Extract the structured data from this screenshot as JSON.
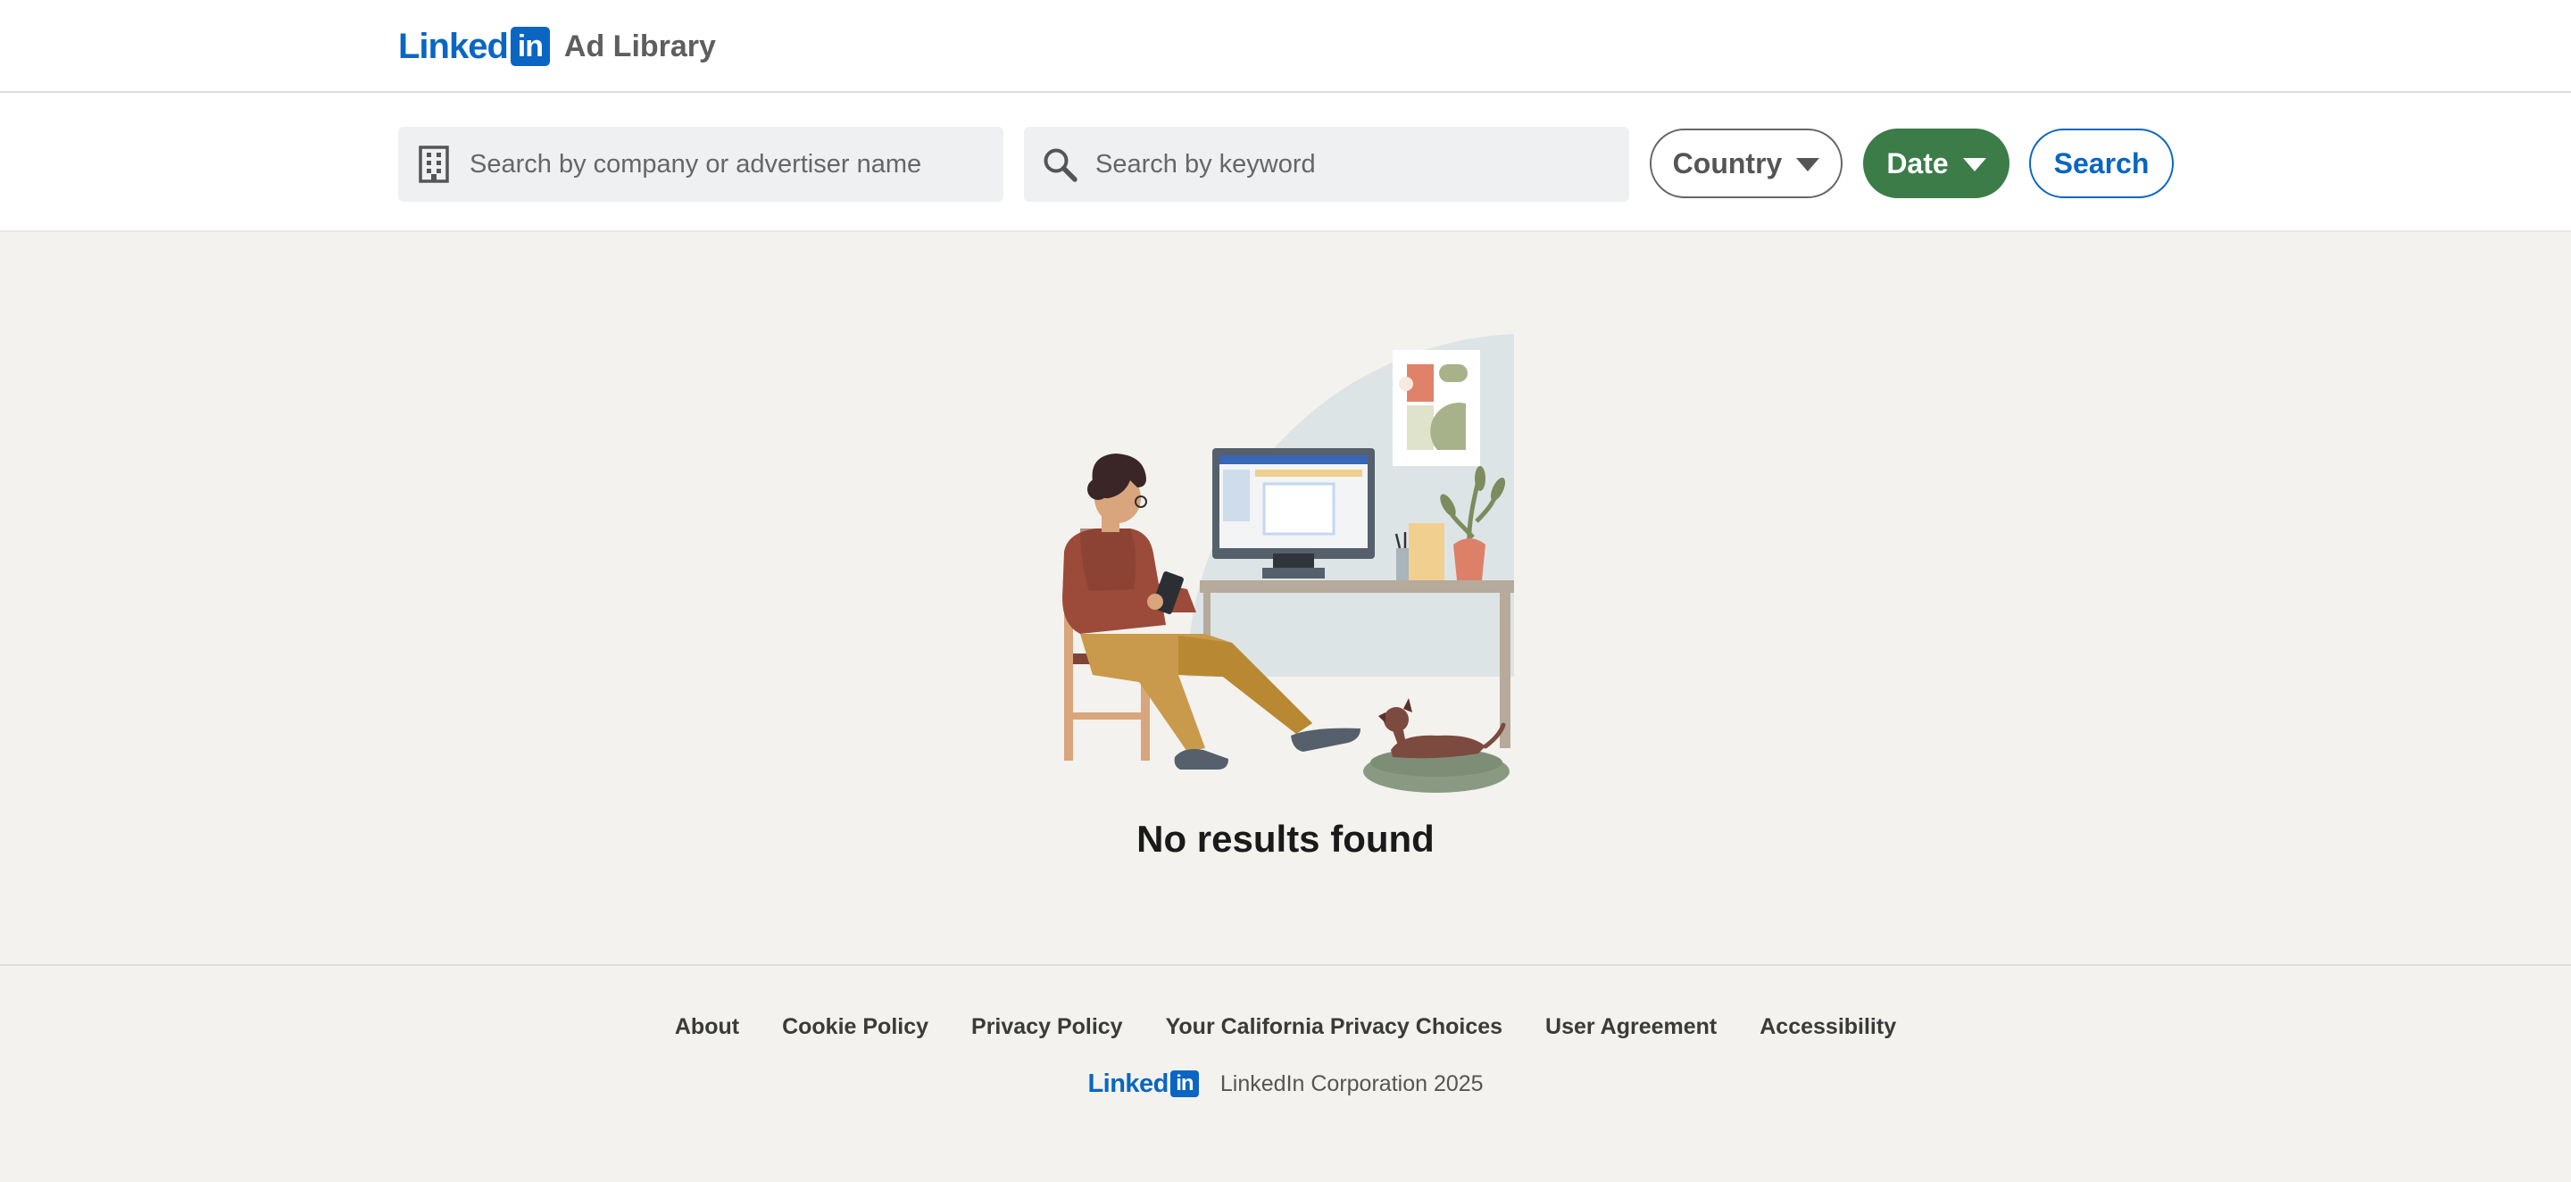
{
  "header": {
    "logo_word": "Linked",
    "logo_box": "in",
    "product": "Ad Library"
  },
  "search": {
    "company_placeholder": "Search by company or advertiser name",
    "company_icon": "building-icon",
    "keyword_placeholder": "Search by keyword",
    "keyword_icon": "search-icon",
    "country_label": "Country",
    "date_label": "Date",
    "search_label": "Search"
  },
  "main": {
    "empty_title": "No results found"
  },
  "footer": {
    "links": [
      {
        "label": "About"
      },
      {
        "label": "Cookie Policy"
      },
      {
        "label": "Privacy Policy"
      },
      {
        "label": "Your California Privacy Choices"
      },
      {
        "label": "User Agreement"
      },
      {
        "label": "Accessibility"
      }
    ],
    "logo_word": "Linked",
    "logo_box": "in",
    "copyright": "LinkedIn Corporation 2025"
  },
  "colors": {
    "brand_blue": "#0a66c2",
    "date_green": "#3b7c48",
    "page_bg": "#f3f2ee"
  }
}
